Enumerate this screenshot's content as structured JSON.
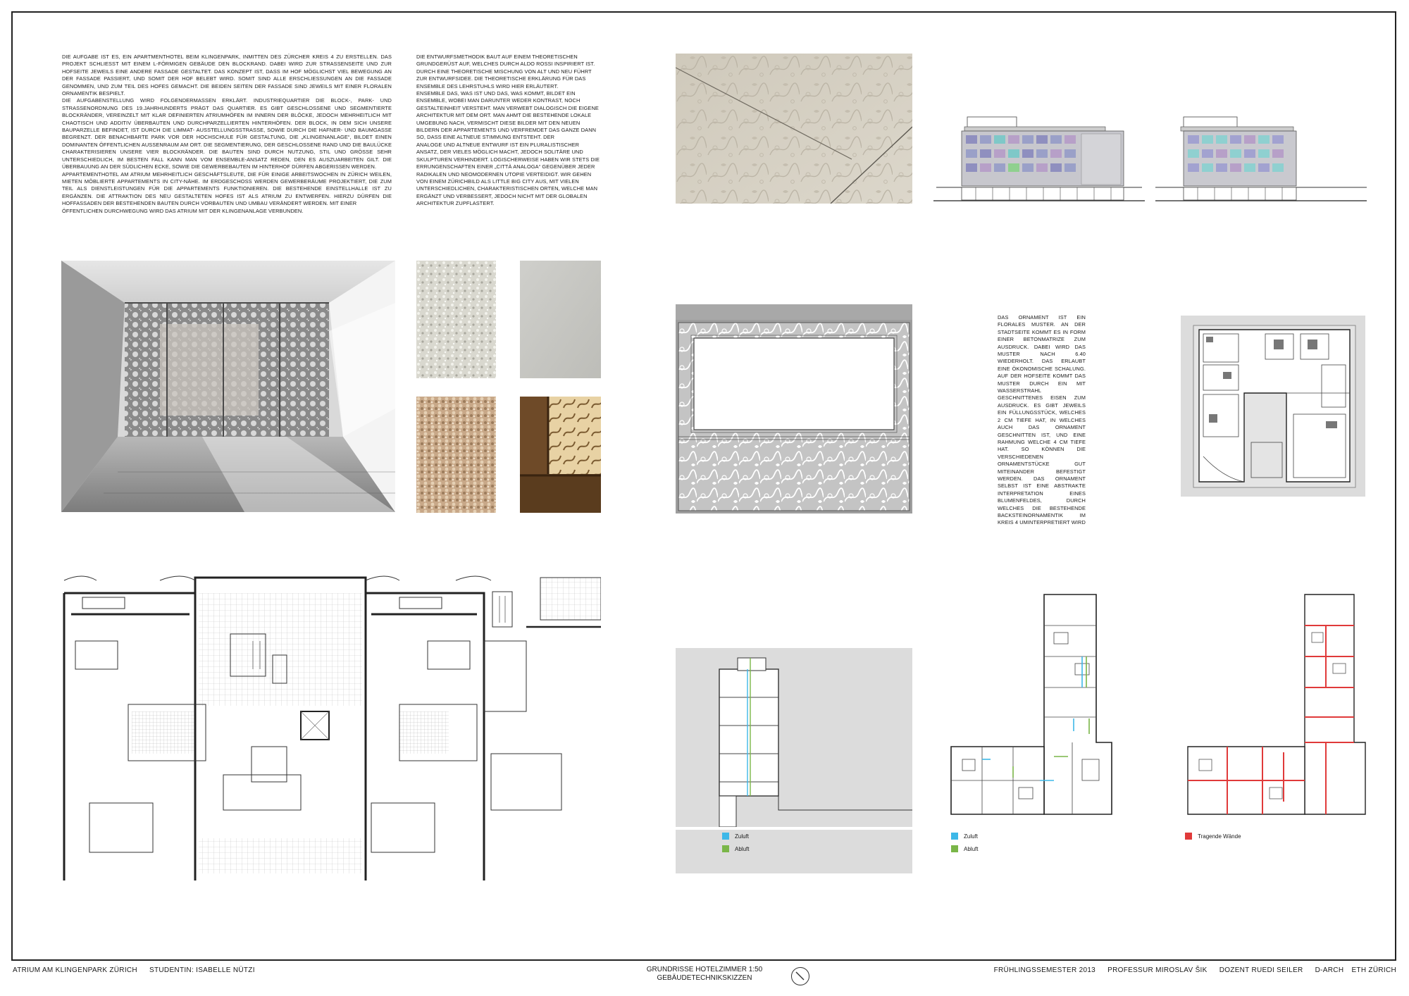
{
  "text_left": [
    "DIE AUFGABE IST ES, EIN APARTMENTHOTEL BEIM KLINGENPARK, INMITTEN DES ZÜRCHER KREIS 4 ZU ERSTELLEN. DAS PROJEKT SCHLIESST MIT EINEM L-FÖRMIGEN GEBÄUDE DEN BLOCKRAND. DABEI WIRD ZUR STRASSENSEITE UND ZUR HOFSEITE JEWEILS EINE ANDERE FASSADE GESTALTET. DAS KONZEPT IST, DASS IM HOF MÖGLICHST VIEL BEWEGUNG AN DER FASSADE PASSIERT, UND SOMIT DER HOF BELEBT WIRD. SOMIT SIND ALLE ERSCHLIESSUNGEN AN DIE FASSADE GENOMMEN, UND ZUM TEIL DES HOFES GEMACHT. DIE BEIDEN SEITEN DER FASSADE SIND JEWEILS MIT EINER FLORALEN ORNAMENTIK BESPIELT.",
    "DIE AUFGABENSTELLUNG WIRD FOLGENDERMASSEN ERKLÄRT. INDUSTRIEQUARTIER DIE BLOCK-, PARK- UND STRASSENORDNUNG DES 19.JAHRHUNDERTS PRÄGT DAS QUARTIER. ES GIBT GESCHLOSSENE UND SEGMENTIERTE BLOCKRÄNDER, VEREINZELT MIT KLAR DEFINIERTEN ATRIUMHÖFEN IM INNERN DER BLÖCKE, JEDOCH MEHRHEITLICH MIT CHAOTISCH UND ADDITIV ÜBERBAUTEN UND DURCHPARZELLIERTEN HINTERHÖFEN. DER BLOCK, IN DEM SICH UNSERE BAUPARZELLE BEFINDET, IST DURCH DIE LIMMAT- AUSSTELLUNGSSTRASSE, SOWIE DURCH DIE HAFNER- UND BAUMGASSE BEGRENZT. DER BENACHBARTE PARK VOR DER HOCHSCHULE FÜR GESTALTUNG, DIE „KLINGENANLAGE“, BILDET EINEN DOMINANTEN ÖFFENTLICHEN AUSSENRAUM AM ORT. DIE SEGMENTIERUNG, DER GESCHLOSSENE RAND UND DIE BAULÜCKE CHARAKTERISIEREN UNSERE VIER BLOCKRÄNDER. DIE BAUTEN SIND DURCH NUTZUNG, STIL UND GRÖSSE SEHR UNTERSCHIEDLICH, IM BESTEN FALL KANN MAN VOM ENSEMBLE-ANSATZ REDEN, DEN ES AUSZUARBEITEN GILT. DIE ÜBERBAUUNG AN DER SÜDLICHEN ECKE, SOWIE DIE GEWERBEBAUTEN IM HINTERHOF DÜRFEN ABGERISSEN WERDEN.",
    "APPARTEMENTHOTEL AM ATRIUM MEHRHEITLICH GESCHÄFTSLEUTE, DIE FÜR EINIGE ARBEITSWOCHEN IN ZÜRICH WEILEN, MIETEN MÖBLIERTE APPARTEMENTS IN CITY-NÄHE. IM ERDGESCHOSS WERDEN GEWERBERÄUME PROJEKTIERT, DIE ZUM TEIL ALS DIENSTLEISTUNGEN FÜR DIE APPARTEMENTS FUNKTIONIEREN. DIE BESTEHENDE EINSTELLHALLE IST ZU ERGÄNZEN. DIE ATTRAKTION DES NEU GESTALTETEN HOFES IST ALS ATRIUM ZU ENTWERFEN. HIERZU DÜRFEN DIE HOFFASSADEN DER BESTEHENDEN BAUTEN DURCH VORBAUTEN UND UMBAU VERÄNDERT WERDEN. MIT EINER",
    "ÖFFENTLICHEN DURCHWEGUNG WIRD DAS ATRIUM MIT DER KLINGENANLAGE VERBUNDEN."
  ],
  "text_mid": [
    "DIE ENTWURFSMETHODIK BAUT AUF EINEM THEORETISCHEN GRUNDGERÜST AUF, WELCHES DURCH ALDO ROSSI INSPIRIERT IST. DURCH EINE THEORETISCHE MISCHUNG VON ALT UND NEU FÜHRT ZUR ENTWURFSIDEE. DIE THEORETISCHE ERKLÄRUNG FÜR DAS ENSEMBLE DES LEHRSTUHLS WIRD HIER ERLÄUTERT.",
    "ENSEMBLE DAS, WAS IST UND DAS, WAS KOMMT, BILDET EIN ENSEMBLE, WOBEI MAN DARUNTER WEDER KONTRAST, NOCH GESTALTEINHEIT VERSTEHT. MAN VERWEBT DIALOGISCH DIE EIGENE ARCHITEKTUR MIT DEM ORT. MAN AHMT DIE BESTEHENDE LOKALE UMGEBUNG NACH, VERMISCHT DIESE BILDER MIT DEN NEUEN BILDERN DER APPARTEMENTS UND VERFREMDET DAS GANZE DANN SO, DASS EINE ALTNEUE STIMMUNG ENTSTEHT. DER",
    "ANALOGE UND ALTNEUE ENTWURF IST EIN PLURALISTISCHER ANSATZ, DER VIELES MÖGLICH MACHT, JEDOCH SOLITÄRE UND SKULPTUREN VERHINDERT. LOGISCHERWEISE HABEN WIR STETS DIE ERRUNGENSCHAFTEN EINER „CITTÀ ANALOGA“ GEGENÜBER JEDER RADIKALEN UND NEOMODERNEN UTOPIE VERTEIDIGT. WIR GEHEN VON EINEM ZÜRICHBILD ALS LITTLE BIG CITY AUS, MIT VIELEN UNTERSCHIEDLICHEN, CHARAKTERISTISCHEN ORTEN, WELCHE MAN ERGÄNZT UND VERBESSERT, JEDOCH NICHT MIT DER GLOBALEN ARCHITEKTUR ZUPFLASTERT."
  ],
  "text_ornament": "DAS ORNAMENT IST EIN FLORALES MUSTER. AN DER STADTSEITE KOMMT ES IN FORM EINER BETONMATRIZE ZUM AUSDRUCK. DABEI WIRD DAS MUSTER NACH 6.40 WIEDERHOLT. DAS ERLAUBT EINE ÖKONOMISCHE SCHALUNG. AUF DER HOFSEITE KOMMT DAS MUSTER DURCH EIN MIT WASSERSTRAHL GESCHNITTENES EISEN ZUM AUSDRUCK. ES GIBT JEWEILS EIN FÜLLUNGSSTÜCK, WELCHES 2 CM TIEFE HAT, IN WELCHES AUCH DAS ORNAMENT GESCHNITTEN IST, UND EINE RAHMUNG WELCHE 4 CM TIEFE HAT. SO KÖNNEN DIE VERSCHIEDENEN ORNAMENTSTÜCKE GUT MITEINANDER BEFESTIGT WERDEN. DAS ORNAMENT SELBST IST EINE ABSTRAKTE INTERPRETATION EINES BLUMENFELDES, DURCH WELCHES DIE BESTEHENDE BACKSTEINORNAMENTIK IM KREIS 4 UMINTERPRETIERT WIRD",
  "legends": {
    "section": [
      {
        "label": "Zuluft",
        "color": "#3db8e8"
      },
      {
        "label": "Abluft",
        "color": "#7ab648"
      }
    ],
    "plan_ventilation": [
      {
        "label": "Zuluft",
        "color": "#3db8e8"
      },
      {
        "label": "Abluft",
        "color": "#7ab648"
      }
    ],
    "plan_structure": [
      {
        "label": "Tragende Wände",
        "color": "#e03a3a"
      }
    ]
  },
  "footer": {
    "left_project": "ATRIUM AM KLINGENPARK ZÜRICH",
    "left_student": "STUDENTIN: ISABELLE NÜTZI",
    "center_line1": "GRUNDRISSE HOTELZIMMER 1:50",
    "center_line2": "GEBÄUDETECHNIKSKIZZEN",
    "right_semester": "FRÜHLINGSSEMESTER 2013",
    "right_professor": "PROFESSUR MIROSLAV ŠIK",
    "right_dozent": "DOZENT RUEDI SEILER",
    "right_dept": "D-ARCH",
    "right_school": "ETH ZÜRICH"
  },
  "icons": [
    "compass-icon"
  ]
}
